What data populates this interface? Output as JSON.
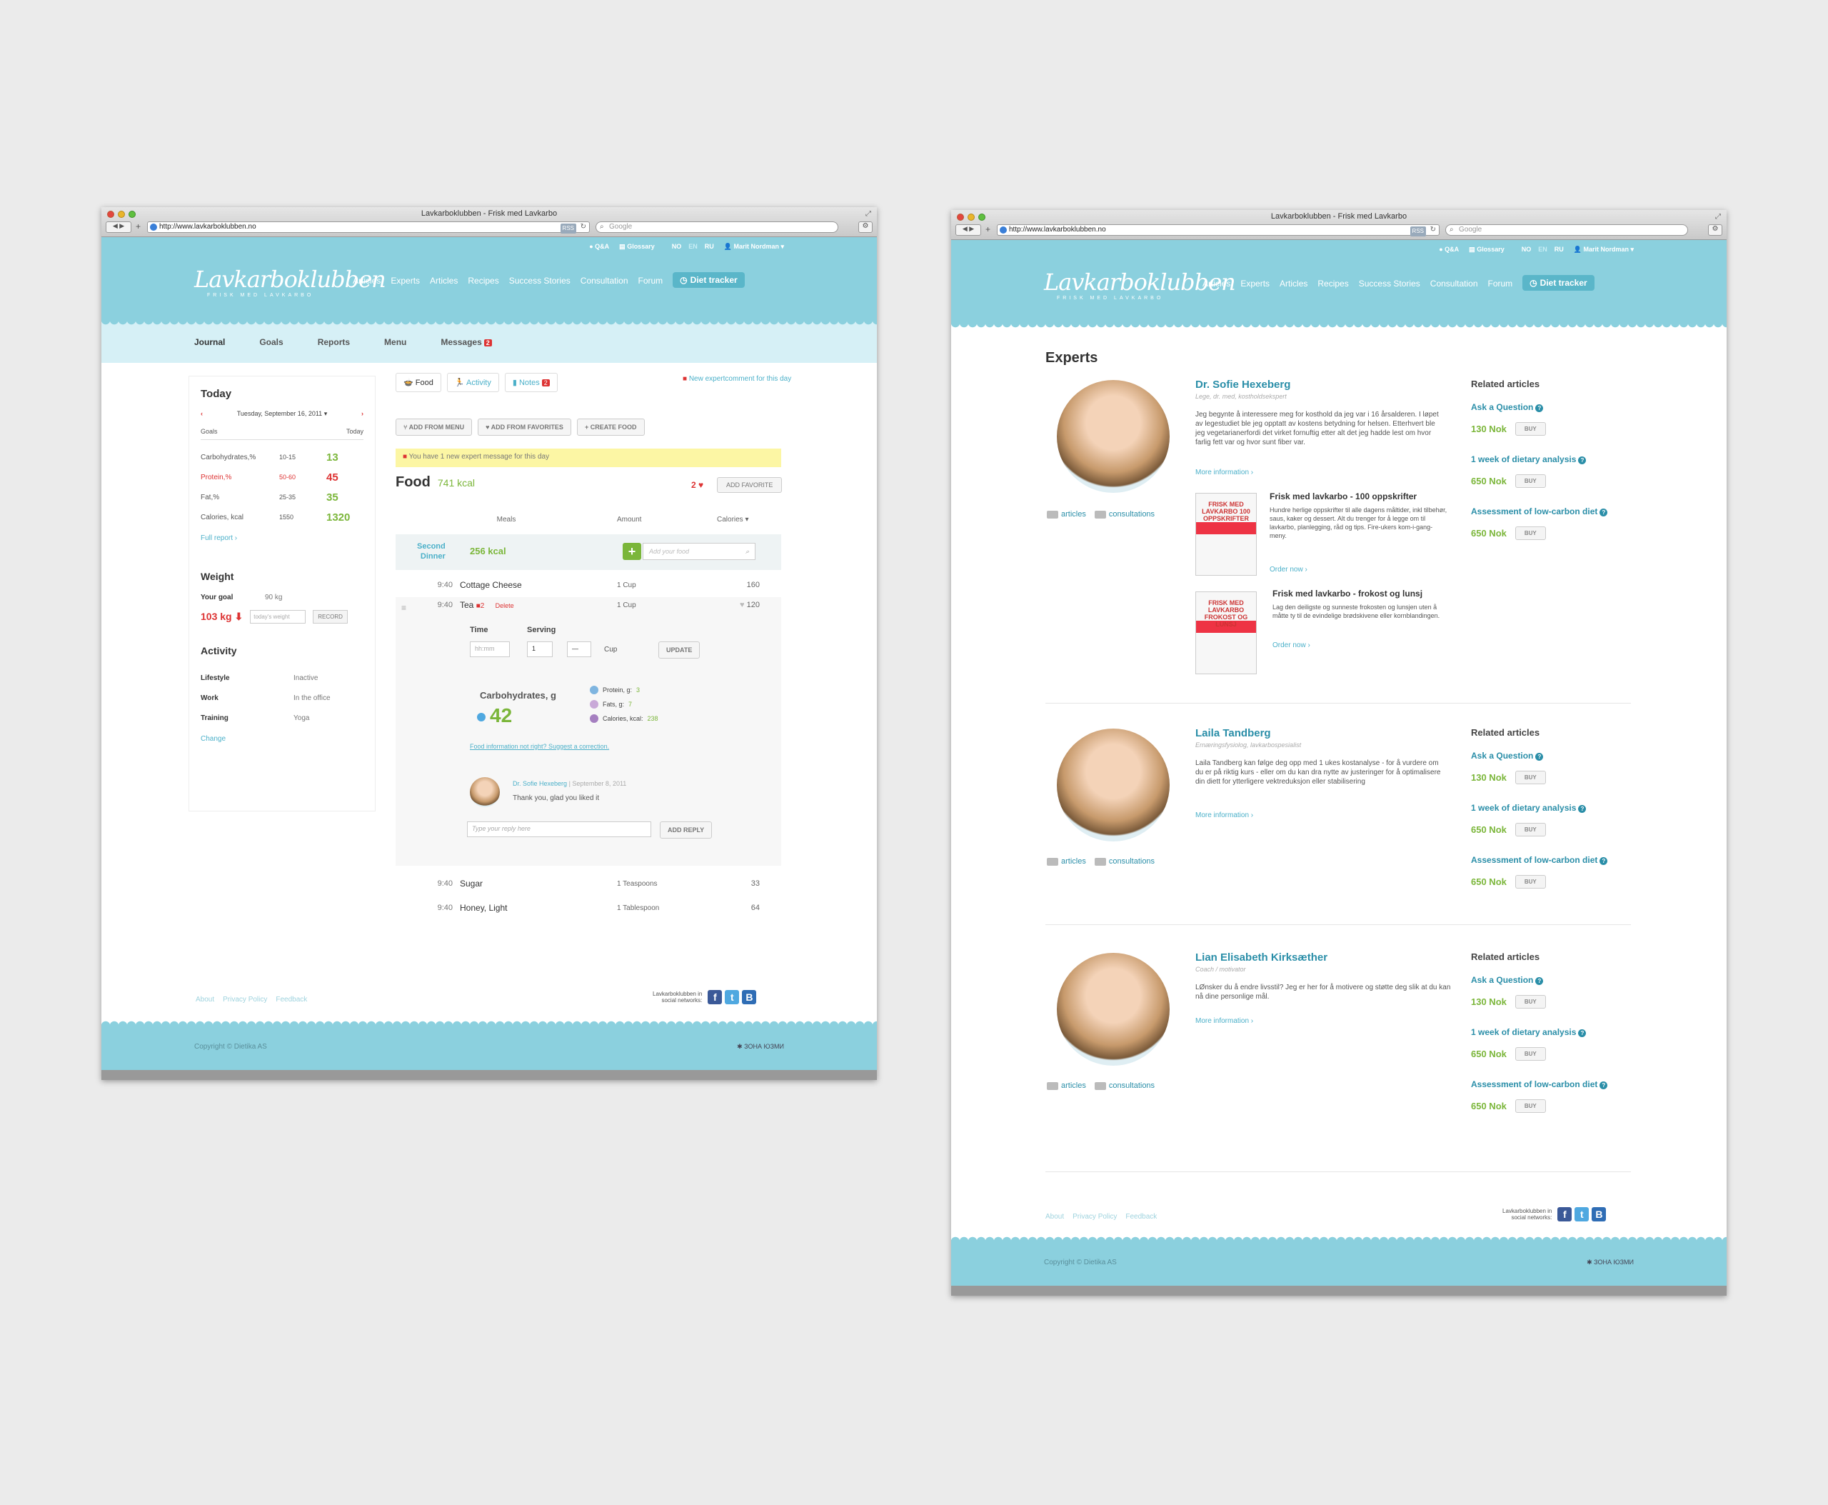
{
  "window_title": "Lavkarboklubben - Frisk med Lavkarbo",
  "url": "http://www.lavkarboklubben.no",
  "search_placeholder": "Google",
  "top": {
    "qa": "Q&A",
    "glossary": "Glossary",
    "lang": [
      "NO",
      "EN",
      "RU"
    ],
    "user": "Marit Nordman"
  },
  "logo": "Lavkarboklubben",
  "tagline": "FRISK MED LAVKARBO",
  "nav": [
    "Articles",
    "Experts",
    "Articles",
    "Recipes",
    "Success Stories",
    "Consultation",
    "Forum"
  ],
  "nav_diet": "Diet tracker",
  "subnav": [
    "Journal",
    "Goals",
    "Reports",
    "Menu",
    "Messages"
  ],
  "messages_count": "2",
  "today": {
    "title": "Today",
    "date": "Tuesday, September 16, 2011",
    "goals_label": "Goals",
    "today_label": "Today",
    "rows": [
      {
        "name": "Carbohydrates,%",
        "goal": "10-15",
        "val": "13"
      },
      {
        "name": "Protein,%",
        "goal": "50-60",
        "val": "45"
      },
      {
        "name": "Fat,%",
        "goal": "25-35",
        "val": "35"
      },
      {
        "name": "Calories, kcal",
        "goal": "1550",
        "val": "1320"
      }
    ],
    "full_report": "Full report",
    "weight_title": "Weight",
    "your_goal": "Your goal",
    "goal_val": "90 kg",
    "weight": "103 kg",
    "weight_placeholder": "today's weight",
    "record": "RECORD",
    "activity_title": "Activity",
    "activity": [
      {
        "k": "Lifestyle",
        "v": "Inactive"
      },
      {
        "k": "Work",
        "v": "In the office"
      },
      {
        "k": "Training",
        "v": "Yoga"
      }
    ],
    "change": "Change"
  },
  "tabs": {
    "food": "Food",
    "activity": "Activity",
    "notes": "Notes",
    "notes_count": "2"
  },
  "expert_note": "New expertcomment for this day",
  "buttons": {
    "add_menu": "ADD FROM MENU",
    "add_fav": "ADD FROM FAVORITES",
    "create": "CREATE FOOD"
  },
  "yellow_msg": "You have 1 new expert message for this day",
  "food": {
    "title": "Food",
    "kcal": "741 kcal",
    "fav_count": "2",
    "add_favorite": "ADD FAVORITE"
  },
  "meal_cols": {
    "meals": "Meals",
    "amount": "Amount",
    "calories": "Calories"
  },
  "meal": {
    "name1": "Second",
    "name2": "Dinner",
    "kcal": "256 kcal",
    "add_placeholder": "Add your food"
  },
  "items": [
    {
      "time": "9:40",
      "name": "Cottage Cheese",
      "amount": "1 Cup",
      "cal": "160"
    },
    {
      "time": "9:40",
      "name": "Tea",
      "amount": "1 Cup",
      "cal": "120"
    },
    {
      "time": "9:40",
      "name": "Sugar",
      "amount": "1 Teaspoons",
      "cal": "33"
    },
    {
      "time": "9:40",
      "name": "Honey, Light",
      "amount": "1 Tablespoon",
      "cal": "64"
    }
  ],
  "edit": {
    "comments": "2",
    "delete": "Delete",
    "time_label": "Time",
    "serving_label": "Serving",
    "time_ph": "hh:mm",
    "serving": "1",
    "unit": "Cup",
    "update": "UPDATE",
    "carb_label": "Carbohydrates, g",
    "carb_val": "42",
    "protein": "Protein, g:",
    "protein_v": "3",
    "fats": "Fats, g:",
    "fats_v": "7",
    "calories": "Calories, kcal:",
    "calories_v": "238",
    "food_info": "Food information not right? Suggest a correction.",
    "comment_author": "Dr. Sofie Hexeberg",
    "comment_date": "September 8, 2011",
    "comment_text": "Thank you, glad you liked it",
    "reply_ph": "Type your reply here",
    "add_reply": "ADD REPLY"
  },
  "footer": {
    "links": [
      "About",
      "Privacy Policy",
      "Feedback"
    ],
    "social_label1": "Lavkarboklubben in",
    "social_label2": "social networks:",
    "copyright": "Copyright © Dietika AS",
    "made": "ЗОНА ЮЗМИ"
  },
  "experts": {
    "title": "Experts",
    "list": [
      {
        "name": "Dr. Sofie Hexeberg",
        "role": "Lege, dr. med, kostholdsekspert",
        "text": "Jeg begynte å interessere meg for kosthold da jeg var i 16 årsalderen. I løpet av legestudiet ble jeg opptatt av kostens betydning for helsen. Etterhvert ble jeg vegetarianerfordi det virket fornuftig etter alt det jeg hadde lest om hvor farlig fett var og hvor sunt fiber var.",
        "articles": "articles",
        "consult": "consultations"
      },
      {
        "name": "Laila Tandberg",
        "role": "Ernæringsfysiolog, lavkarbospesialist",
        "text": "Laila Tandberg kan følge deg opp med 1 ukes kostanalyse - for å vurdere om du er på riktig kurs - eller om du kan dra nytte av justeringer for å optimalisere din diett for ytterligere vektreduksjon eller stabilisering",
        "articles": "articles",
        "consult": "consultations"
      },
      {
        "name": "Lian Elisabeth Kirksæther",
        "role": "Coach / motivator",
        "text": "LØnsker du å endre livsstil? Jeg er her for å motivere og støtte deg slik at du kan nå dine personlige mål.",
        "articles": "articles",
        "consult": "consultations"
      }
    ],
    "more": "More information",
    "books": [
      {
        "title": "Frisk med lavkarbo - 100 oppskrifter",
        "text": "Hundre herlige oppskrifter til alle dagens måltider, inkl tilbehør, saus, kaker og dessert. Alt du trenger for å legge om til lavkarbo, planlegging, råd og tips. Fire-ukers kom-i-gang-meny.",
        "cover": "FRISK MED LAVKARBO 100 OPPSKRIFTER"
      },
      {
        "title": "Frisk med lavkarbo - frokost og lunsj",
        "text": "Lag den deiligste og sunneste frokosten og lunsjen uten å måtte ty til de evindelige brødskivene eller kornblandingen.",
        "cover": "FRISK MED LAVKARBO FROKOST OG LUNSJ"
      }
    ],
    "order": "Order now",
    "related_title": "Related articles",
    "related": [
      {
        "title": "Ask a Question",
        "price": "130 Nok"
      },
      {
        "title": "1 week of dietary analysis",
        "price": "650 Nok"
      },
      {
        "title": "Assessment of low-carbon diet",
        "price": "650 Nok"
      }
    ],
    "buy": "BUY"
  }
}
